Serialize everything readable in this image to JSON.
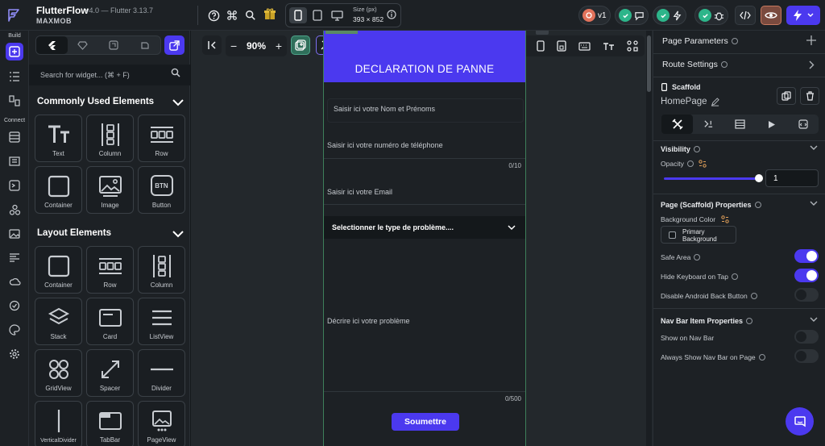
{
  "app": {
    "name": "FlutterFlow",
    "version": "v4.0 — Flutter 3.13.7",
    "project": "MAXMOB"
  },
  "topbar": {
    "size_label": "Size (px)",
    "size_value": "393 × 852",
    "branch_label": "v1"
  },
  "rail": {
    "build_label": "Build",
    "connect_label": "Connect"
  },
  "widgets": {
    "search_placeholder": "Search for widget... (⌘ + F)",
    "common_title": "Commonly Used Elements",
    "common_items": [
      "Text",
      "Column",
      "Row",
      "Container",
      "Image",
      "Button"
    ],
    "layout_title": "Layout Elements",
    "layout_items": [
      "Container",
      "Row",
      "Column",
      "Stack",
      "Card",
      "ListView",
      "GridView",
      "Spacer",
      "Divider",
      "VerticalDivider",
      "TabBar",
      "PageView"
    ],
    "button_glyph": "BTN"
  },
  "canvas": {
    "zoom": "90%",
    "zoom_minus": "−",
    "zoom_plus": "+"
  },
  "phone": {
    "appbar_title": "DECLARATION DE PANNE",
    "name_field": "Saisir ici votre Nom et Prénoms",
    "phone_field": "Saisir ici votre numéro de téléphone",
    "phone_counter": "0/10",
    "email_field": "Saisir ici votre Email",
    "dropdown_placeholder": "Selectionner le type de problème....",
    "description_field": "Décrire ici votre problème",
    "description_counter": "0/500",
    "submit_label": "Soumettre"
  },
  "properties": {
    "page_parameters": "Page Parameters",
    "route_settings": "Route Settings",
    "widget_type": "Scaffold",
    "page_name": "HomePage",
    "visibility_title": "Visibility",
    "opacity_label": "Opacity",
    "opacity_value": "1",
    "opacity_fraction": 1,
    "scaffold_title": "Page (Scaffold) Properties",
    "bg_color_label": "Background Color",
    "bg_color_value_line1": "Primary",
    "bg_color_value_line2": "Background",
    "safe_area_label": "Safe Area",
    "safe_area_on": true,
    "hide_keyboard_label": "Hide Keyboard on Tap",
    "hide_keyboard_on": true,
    "disable_back_label": "Disable Android Back Button",
    "disable_back_on": false,
    "navbar_title": "Nav Bar Item Properties",
    "show_navbar_label": "Show on Nav Bar",
    "show_navbar_on": false,
    "always_show_label": "Always Show Nav Bar on Page",
    "always_show_on": false
  },
  "colors": {
    "accent": "#4b39ef",
    "success": "#2db58a",
    "background": "#14181b",
    "panel": "#1d2125"
  }
}
